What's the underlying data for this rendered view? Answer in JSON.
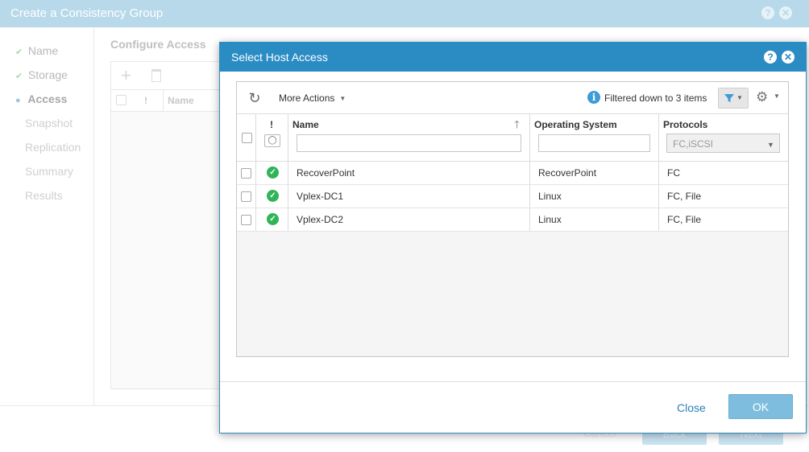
{
  "background": {
    "title": "Create a Consistency Group",
    "steps": [
      {
        "label": "Name",
        "state": "done"
      },
      {
        "label": "Storage",
        "state": "done"
      },
      {
        "label": "Access",
        "state": "active"
      },
      {
        "label": "Snapshot",
        "state": "pending"
      },
      {
        "label": "Replication",
        "state": "pending"
      },
      {
        "label": "Summary",
        "state": "pending"
      },
      {
        "label": "Results",
        "state": "pending"
      }
    ],
    "content_title": "Configure Access",
    "table_headers": {
      "status": "!",
      "name": "Name"
    },
    "buttons": {
      "cancel": "Cancel",
      "back": "Back",
      "next": "Next"
    }
  },
  "modal": {
    "title": "Select Host Access",
    "toolbar": {
      "more_actions": "More Actions",
      "filter_status": "Filtered down to 3 items"
    },
    "columns": {
      "status": "!",
      "name": "Name",
      "os": "Operating System",
      "protocols": "Protocols"
    },
    "filters": {
      "name_value": "",
      "os_value": "",
      "protocols_value": "FC,iSCSI"
    },
    "rows": [
      {
        "name": "RecoverPoint",
        "os": "RecoverPoint",
        "protocols": "FC"
      },
      {
        "name": "Vplex-DC1",
        "os": "Linux",
        "protocols": "FC, File"
      },
      {
        "name": "Vplex-DC2",
        "os": "Linux",
        "protocols": "FC, File"
      }
    ],
    "footer": {
      "close": "Close",
      "ok": "OK"
    }
  },
  "colors": {
    "modal_header": "#2b8cc4",
    "bg_titlebar": "#b7d9ea",
    "status_ok": "#2fb557",
    "ok_button": "#7fbddf",
    "link": "#2b7fb8"
  },
  "icons": {
    "help": "help-icon",
    "close": "close-icon",
    "refresh": "refresh-icon",
    "info": "info-icon",
    "filter": "funnel-icon",
    "settings": "gear-icon",
    "status": "check-circle-icon"
  }
}
